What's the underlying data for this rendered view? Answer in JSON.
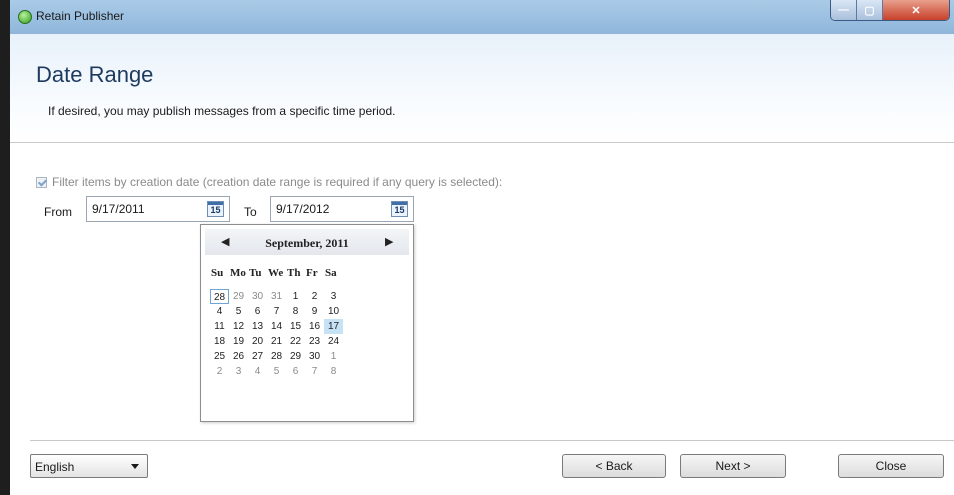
{
  "window": {
    "title": "Retain Publisher",
    "controls": {
      "minimize": "—",
      "maximize": "▢",
      "close": "✕"
    }
  },
  "header": {
    "title": "Date Range",
    "subtitle": "If desired, you may publish messages from a specific time period."
  },
  "filter": {
    "checked": true,
    "label": "Filter items by creation date (creation date range is required if any query is selected):"
  },
  "from": {
    "label": "From",
    "value": "9/17/2011",
    "cal_icon": "15"
  },
  "to": {
    "label": "To",
    "value": "9/17/2012",
    "cal_icon": "15"
  },
  "calendar": {
    "month": "September, 2011",
    "prev": "◀",
    "next": "▶",
    "days_of_week": [
      "Su",
      "Mo",
      "Tu",
      "We",
      "Th",
      "Fr",
      "Sa"
    ],
    "weeks": [
      [
        "28",
        "29",
        "30",
        "31",
        "1",
        "2",
        "3"
      ],
      [
        "4",
        "5",
        "6",
        "7",
        "8",
        "9",
        "10"
      ],
      [
        "11",
        "12",
        "13",
        "14",
        "15",
        "16",
        "17"
      ],
      [
        "18",
        "19",
        "20",
        "21",
        "22",
        "23",
        "24"
      ],
      [
        "25",
        "26",
        "27",
        "28",
        "29",
        "30",
        "1"
      ],
      [
        "2",
        "3",
        "4",
        "5",
        "6",
        "7",
        "8"
      ]
    ],
    "other_month_days": [
      "0-1",
      "0-2",
      "0-3",
      "4-6",
      "5-0",
      "5-1",
      "5-2",
      "5-3",
      "5-4",
      "5-5",
      "5-6"
    ],
    "today_cell": "0-0",
    "selected_cell": "2-6"
  },
  "footer": {
    "language": "English",
    "back": "< Back",
    "next": "Next >",
    "close": "Close"
  },
  "colors": {
    "title_text": "#1e3a5f",
    "selected_day": "#c6e2f5",
    "today_border": "#6ea4d6"
  }
}
